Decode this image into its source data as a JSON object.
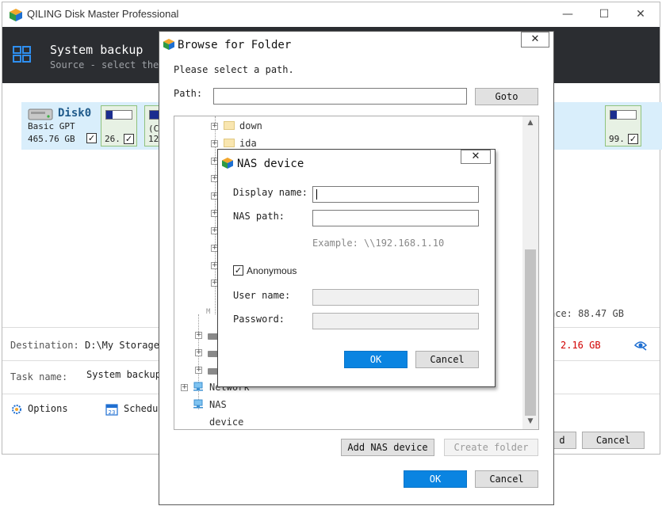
{
  "main_window": {
    "title": "QILING Disk Master Professional",
    "controls": {
      "minimize": "—",
      "maximize": "☐",
      "close": "✕"
    },
    "header": {
      "title": "System backup",
      "subtitle": "Source - select the"
    },
    "disk": {
      "name": "Disk0",
      "type": "Basic GPT",
      "size": "465.76 GB",
      "checked": true,
      "partitions": [
        {
          "text": "26.",
          "checked": true,
          "usage_fraction": 0.25
        },
        {
          "text": "(C",
          "text2": "12",
          "checked": true,
          "usage_fraction": 0.4
        },
        {
          "text": "99.",
          "checked": true,
          "usage_fraction": 0.25
        }
      ]
    },
    "space_label": "ace: 88.47 GB",
    "destination": {
      "label": "Destination:",
      "value": "D:\\My Storage",
      "size": "2.16 GB"
    },
    "task": {
      "label": "Task name:",
      "value": "System backup"
    },
    "options_label": "Options",
    "schedule_label": "Schedu",
    "schedule_icon_number": "23",
    "buttons": {
      "next": "d",
      "cancel": "Cancel"
    }
  },
  "browse_dialog": {
    "title": "Browse for Folder",
    "close": "✕",
    "prompt": "Please select a path.",
    "path_label": "Path:",
    "path_value": "",
    "goto": "Goto",
    "tree_items": [
      {
        "label": "down",
        "kind": "folder"
      },
      {
        "label": "ida",
        "kind": "folder"
      }
    ],
    "tree_fragment": "M",
    "tree_bottom_items": [
      {
        "label": "Network",
        "kind": "network"
      },
      {
        "label": "NAS device",
        "kind": "network"
      }
    ],
    "add_nas": "Add NAS device",
    "create_folder": "Create folder",
    "ok": "OK",
    "cancel": "Cancel"
  },
  "nas_dialog": {
    "title": "NAS device",
    "close": "✕",
    "display_name_label": "Display name:",
    "display_name_value": "",
    "nas_path_label": "NAS path:",
    "nas_path_value": "",
    "example": "Example: \\\\192.168.1.10",
    "anonymous_label": "Anonymous",
    "anonymous_checked": true,
    "user_label": "User name:",
    "password_label": "Password:",
    "ok": "OK",
    "cancel": "Cancel"
  },
  "colors": {
    "header_bg": "#2b2d31",
    "accent_blue": "#0a84e1",
    "disk_row_bg": "#d9eefb",
    "size_red": "#d10000"
  }
}
